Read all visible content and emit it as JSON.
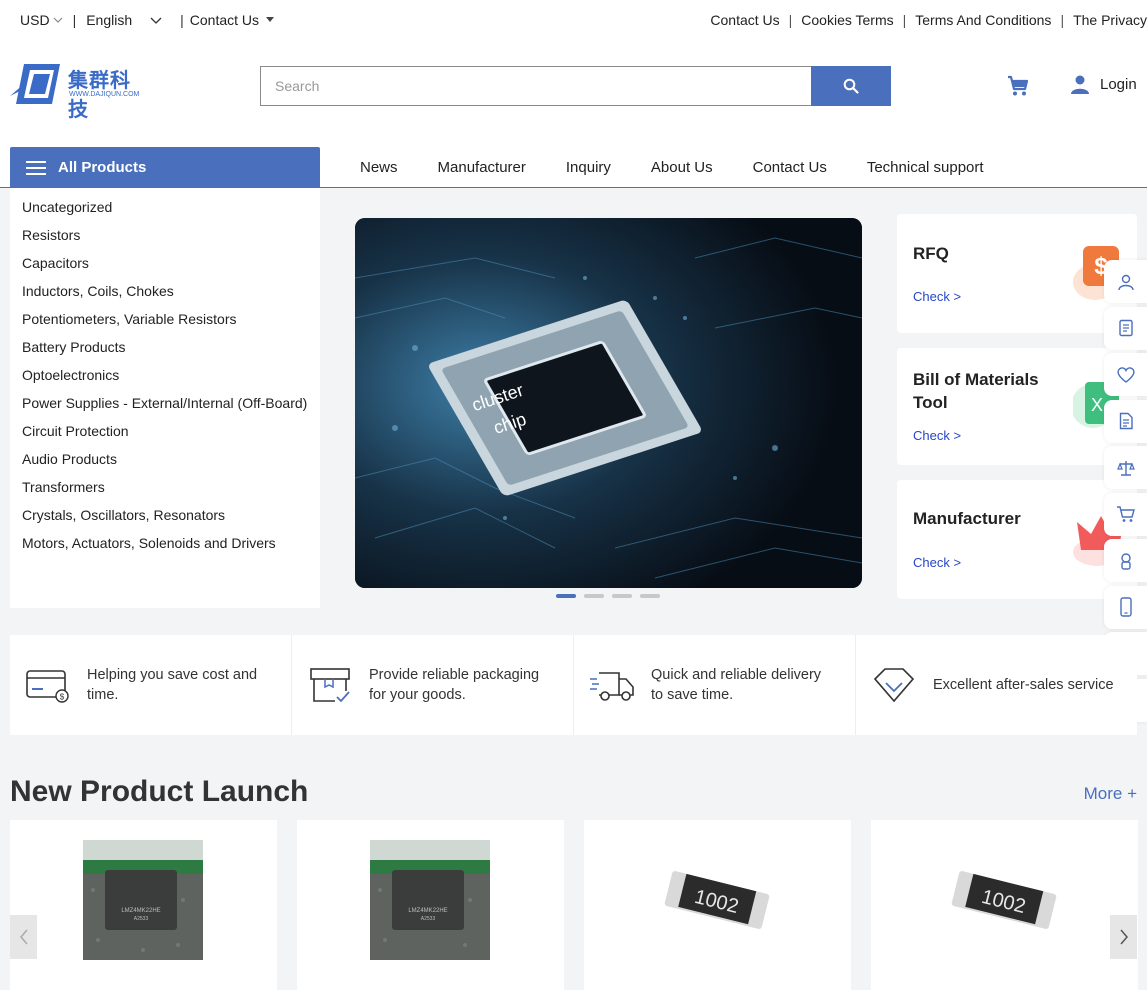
{
  "topbar": {
    "currency": "USD",
    "language": "English",
    "contact_dropdown": "Contact Us",
    "links": [
      "Contact Us",
      "Cookies Terms",
      "Terms And Conditions",
      "The Privacy"
    ]
  },
  "header": {
    "logo_cn": "集群科技",
    "logo_url": "WWW.DAJIQUN.COM",
    "search_placeholder": "Search",
    "login_label": "Login"
  },
  "nav": {
    "all_products": "All Products",
    "items": [
      "News",
      "Manufacturer",
      "Inquiry",
      "About Us",
      "Contact Us",
      "Technical support"
    ]
  },
  "categories": [
    "Uncategorized",
    "Resistors",
    "Capacitors",
    "Inductors, Coils, Chokes",
    "Potentiometers, Variable Resistors",
    "Battery Products",
    "Optoelectronics",
    "Power Supplies - External/Internal (Off-Board)",
    "Circuit Protection",
    "Audio Products",
    "Transformers",
    "Crystals, Oscillators, Resonators",
    "Motors, Actuators, Solenoids and Drivers"
  ],
  "banner": {
    "chip_text_1": "cluster",
    "chip_text_2": "chip",
    "slide_count": 4,
    "active_slide": 1
  },
  "cards": [
    {
      "title": "RFQ",
      "check": "Check  >",
      "icon": "dollar-icon",
      "color": "#f07a3d"
    },
    {
      "title": "Bill of Materials Tool",
      "check": "Check  >",
      "icon": "excel-icon",
      "color": "#3fbf7f"
    },
    {
      "title": "Manufacturer",
      "check": "Check  >",
      "icon": "crown-icon",
      "color": "#f25b5b"
    }
  ],
  "sidebar_icons": [
    "user-icon",
    "document-icon",
    "heart-icon",
    "file-icon",
    "scale-icon",
    "cart-icon",
    "support-icon",
    "phone-icon",
    "mail-icon",
    "chat-icon"
  ],
  "features": [
    "Helping you save cost and time.",
    "Provide reliable packaging for your goods.",
    "Quick and reliable delivery to save time.",
    "Excellent after-sales service"
  ],
  "new_products": {
    "title": "New Product Launch",
    "more": "More +",
    "chip_label_1": "LMZ4MK22HE",
    "chip_label_2": "A2533",
    "resistor_label": "1002"
  },
  "colors": {
    "accent": "#4a6fbd",
    "link": "#2746c7"
  }
}
